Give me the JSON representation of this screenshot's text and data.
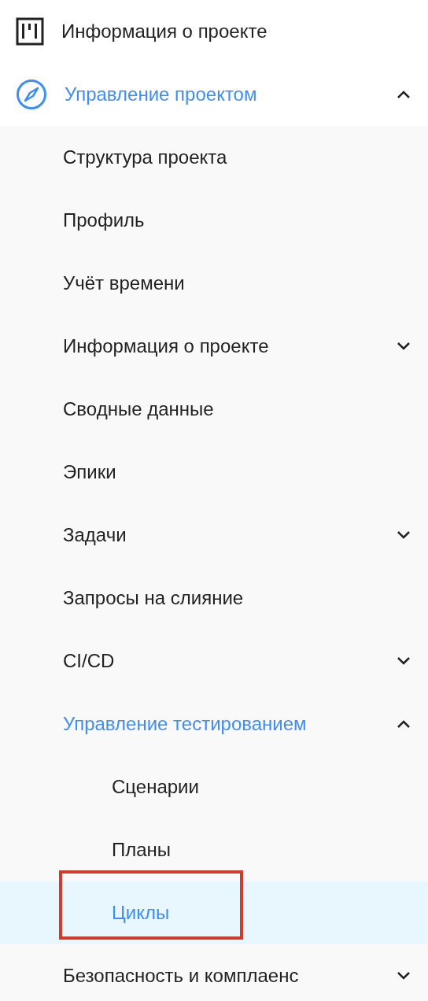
{
  "sidebar": {
    "items": [
      {
        "label": "Информация о проекте",
        "selected": false
      },
      {
        "label": "Управление проектом",
        "selected": true,
        "expanded": true,
        "children": [
          {
            "label": "Структура проекта",
            "selected": false
          },
          {
            "label": "Профиль",
            "selected": false
          },
          {
            "label": "Учёт времени",
            "selected": false
          },
          {
            "label": "Информация о проекте",
            "selected": false,
            "expanded": false
          },
          {
            "label": "Сводные данные",
            "selected": false
          },
          {
            "label": "Эпики",
            "selected": false
          },
          {
            "label": "Задачи",
            "selected": false,
            "expanded": false
          },
          {
            "label": "Запросы на слияние",
            "selected": false
          },
          {
            "label": "CI/CD",
            "selected": false,
            "expanded": false
          },
          {
            "label": "Управление тестированием",
            "selected": true,
            "expanded": true,
            "children": [
              {
                "label": "Сценарии",
                "selected": false
              },
              {
                "label": "Планы",
                "selected": false
              },
              {
                "label": "Циклы",
                "selected": true,
                "current": true,
                "annotated": true
              }
            ]
          },
          {
            "label": "Безопасность и комплаенс",
            "selected": false,
            "expanded": false
          }
        ]
      }
    ]
  }
}
